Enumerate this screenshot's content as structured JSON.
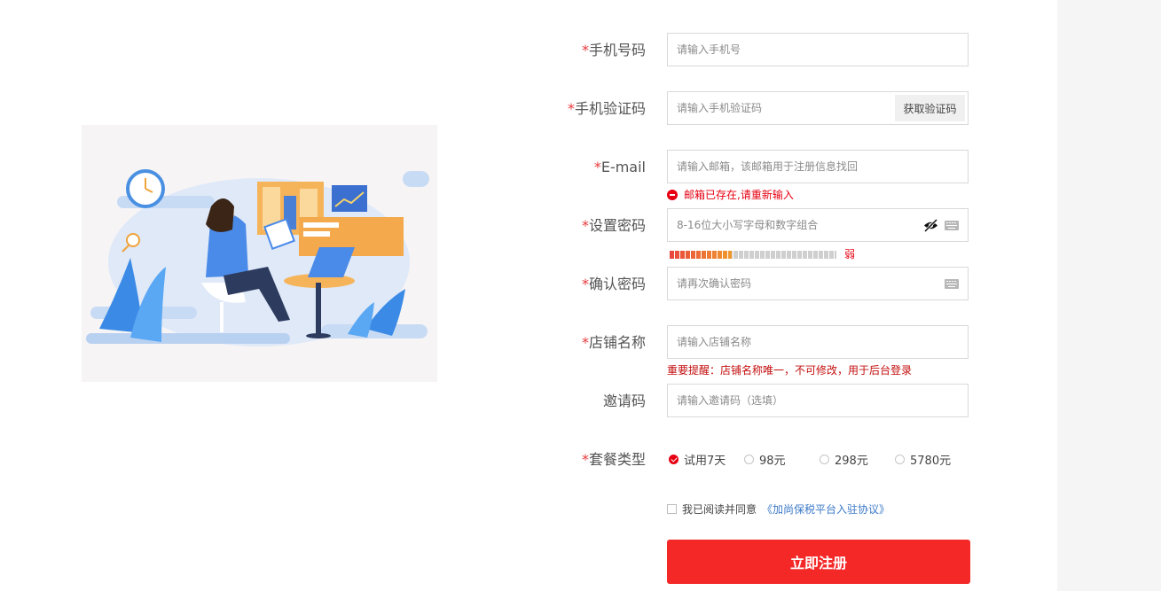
{
  "form": {
    "phone": {
      "required": "*",
      "label": "手机号码",
      "placeholder": "请输入手机号"
    },
    "sms_code": {
      "required": "*",
      "label": "手机验证码",
      "placeholder": "请输入手机验证码",
      "button_label": "获取验证码"
    },
    "email": {
      "required": "*",
      "label": "E-mail",
      "placeholder": "请输入邮箱，该邮箱用于注册信息找回",
      "error": "邮箱已存在,请重新输入"
    },
    "password": {
      "required": "*",
      "label": "设置密码",
      "placeholder": "8-16位大小写字母和数字组合",
      "strength_label": "弱",
      "strength_level": 0.37
    },
    "confirm_password": {
      "required": "*",
      "label": "确认密码",
      "placeholder": "请再次确认密码"
    },
    "shop_name": {
      "required": "*",
      "label": "店铺名称",
      "placeholder": "请输入店铺名称",
      "tip": "重要提醒：店铺名称唯一，不可修改，用于后台登录"
    },
    "invite_code": {
      "label": "邀请码",
      "placeholder": "请输入邀请码（选填）"
    },
    "plan": {
      "required": "*",
      "label": "套餐类型",
      "options": [
        {
          "label": "试用7天",
          "selected": true
        },
        {
          "label": "98元",
          "selected": false
        },
        {
          "label": "298元",
          "selected": false
        },
        {
          "label": "5780元",
          "selected": false
        }
      ]
    },
    "agreement": {
      "text": "我已阅读并同意",
      "link": "《加尚保税平台入驻协议》",
      "checked": false
    },
    "submit_label": "立即注册"
  },
  "colors": {
    "accent": "#f52828",
    "error": "#e60012",
    "link": "#3c7ac8"
  },
  "icons": [
    "eye-off-icon",
    "keyboard-icon",
    "error-icon",
    "check-icon"
  ]
}
